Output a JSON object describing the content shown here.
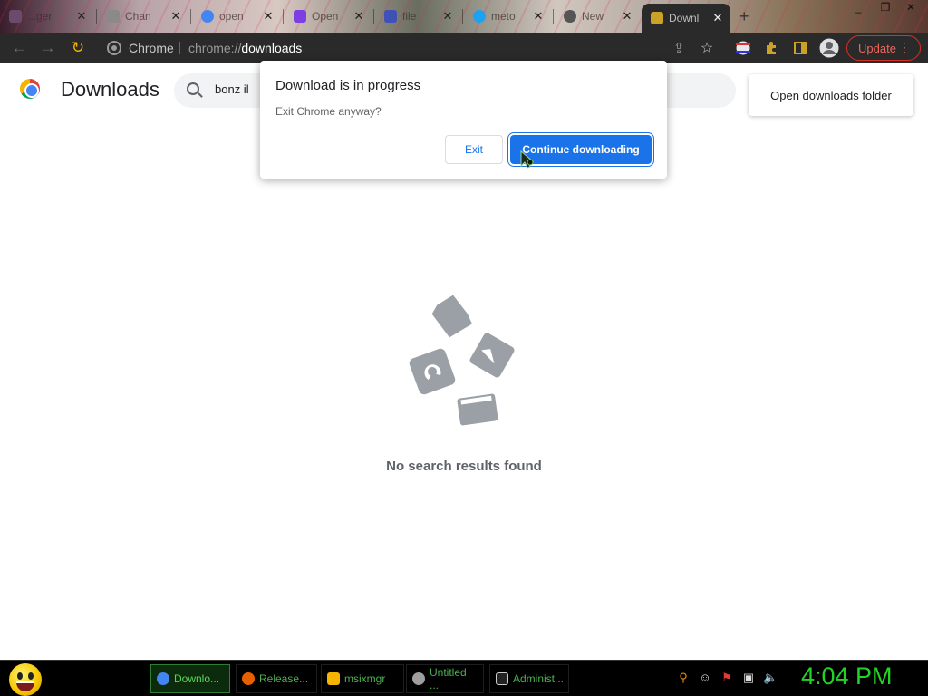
{
  "tabs": [
    {
      "label": "...ger",
      "favicon_color": "#6b4b6b"
    },
    {
      "label": "Chan",
      "favicon_color": "#8a8a8a"
    },
    {
      "label": "open",
      "favicon_color": "#4285f4"
    },
    {
      "label": "Open",
      "favicon_color": "#7b3fe4"
    },
    {
      "label": "file",
      "favicon_color": "#3f51b5"
    },
    {
      "label": "meto",
      "favicon_color": "#1da1f2"
    },
    {
      "label": "New",
      "favicon_color": "#555555"
    },
    {
      "label": "Downl",
      "favicon_color": "#c9a227"
    }
  ],
  "toolbar": {
    "chrome_label": "Chrome",
    "url_prefix": "chrome://",
    "url_path": "downloads",
    "update_label": "Update"
  },
  "page": {
    "title": "Downloads",
    "search_value": "bonz il",
    "open_folder_label": "Open downloads folder",
    "no_results": "No search results found"
  },
  "dialog": {
    "title": "Download is in progress",
    "message": "Exit Chrome anyway?",
    "exit_label": "Exit",
    "continue_label": "Continue downloading"
  },
  "taskbar": {
    "items": [
      {
        "label": "Downlo...",
        "icon": "chrome-icon",
        "color": "#4285f4"
      },
      {
        "label": "Release...",
        "icon": "firefox-icon",
        "color": "#e66000"
      },
      {
        "label": "msixmgr",
        "icon": "file-icon",
        "color": "#f4b400"
      },
      {
        "label": "Untitled ...",
        "icon": "paint-icon",
        "color": "#9e9e9e"
      },
      {
        "label": "Administ...",
        "icon": "console-icon",
        "color": "#cccccc"
      }
    ],
    "clock": "4:04 PM"
  },
  "colors": {
    "accent": "#1a73e8",
    "update_red": "#d93025",
    "taskbar_green": "#22d422"
  }
}
